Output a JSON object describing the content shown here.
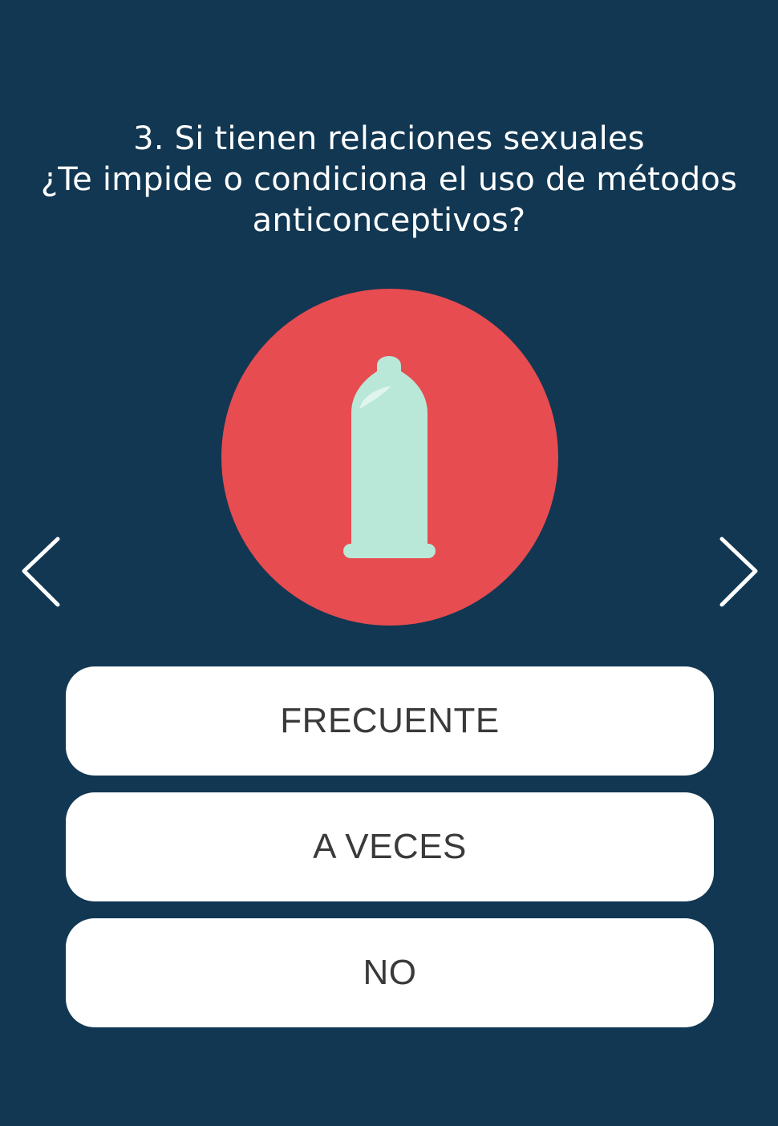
{
  "question": {
    "line1": "3. Si tienen relaciones sexuales",
    "line2": "¿Te impide o condiciona el uso de métodos",
    "line3": "anticonceptivos?"
  },
  "illustration": {
    "icon": "condom-icon",
    "circle_color": "#E74C50",
    "icon_color": "#B9E8D9"
  },
  "navigation": {
    "prev_icon": "chevron-left-icon",
    "next_icon": "chevron-right-icon"
  },
  "options": [
    {
      "label": "FRECUENTE"
    },
    {
      "label": "A VECES"
    },
    {
      "label": "NO"
    }
  ],
  "colors": {
    "background": "#113752",
    "option_background": "#FFFFFF",
    "option_text": "#3A3A3A"
  }
}
